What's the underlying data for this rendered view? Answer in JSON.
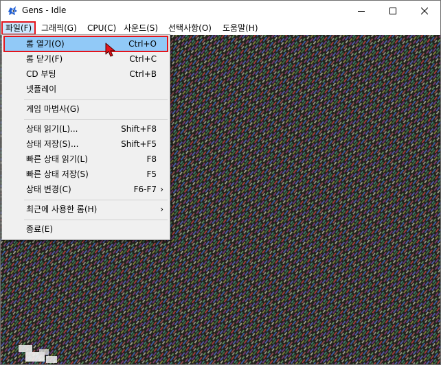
{
  "window": {
    "title": "Gens - Idle",
    "app_icon": "sonic-icon",
    "controls": [
      "minimize-icon",
      "maximize-icon",
      "close-icon"
    ]
  },
  "menubar": [
    {
      "label": "파일(F)"
    },
    {
      "label": "그래픽(G)"
    },
    {
      "label": "CPU(C)"
    },
    {
      "label": "사운드(S)"
    },
    {
      "label": "선택사항(O)"
    },
    {
      "label": "도움말(H)"
    }
  ],
  "file_menu": {
    "items": [
      {
        "label": "롬 열기(O)",
        "shortcut": "Ctrl+O",
        "submenu": "",
        "selected": true
      },
      {
        "label": "롬 닫기(F)",
        "shortcut": "Ctrl+C",
        "submenu": ""
      },
      {
        "label": "CD 부팅",
        "shortcut": "Ctrl+B",
        "submenu": ""
      },
      {
        "label": "넷플레이",
        "shortcut": "",
        "submenu": ""
      },
      {
        "label": "게임 마법사(G)",
        "shortcut": "",
        "submenu": ""
      },
      {
        "label": "상태 읽기(L)...",
        "shortcut": "Shift+F8",
        "submenu": ""
      },
      {
        "label": "상태 저장(S)...",
        "shortcut": "Shift+F5",
        "submenu": ""
      },
      {
        "label": "빠른 상태 읽기(L)",
        "shortcut": "F8",
        "submenu": ""
      },
      {
        "label": "빠른 상태 저장(S)",
        "shortcut": "F5",
        "submenu": ""
      },
      {
        "label": "상태 변경(C)",
        "shortcut": "F6-F7",
        "submenu": "›"
      },
      {
        "label": "최근에 사용한 롬(H)",
        "shortcut": "",
        "submenu": "›"
      },
      {
        "label": "종료(E)",
        "shortcut": "",
        "submenu": ""
      }
    ]
  },
  "colors": {
    "highlight": "#91c9f7",
    "annotation_red": "#e3141b",
    "menu_bg": "#f0f0f0"
  },
  "pointer": "mouse-cursor-icon"
}
